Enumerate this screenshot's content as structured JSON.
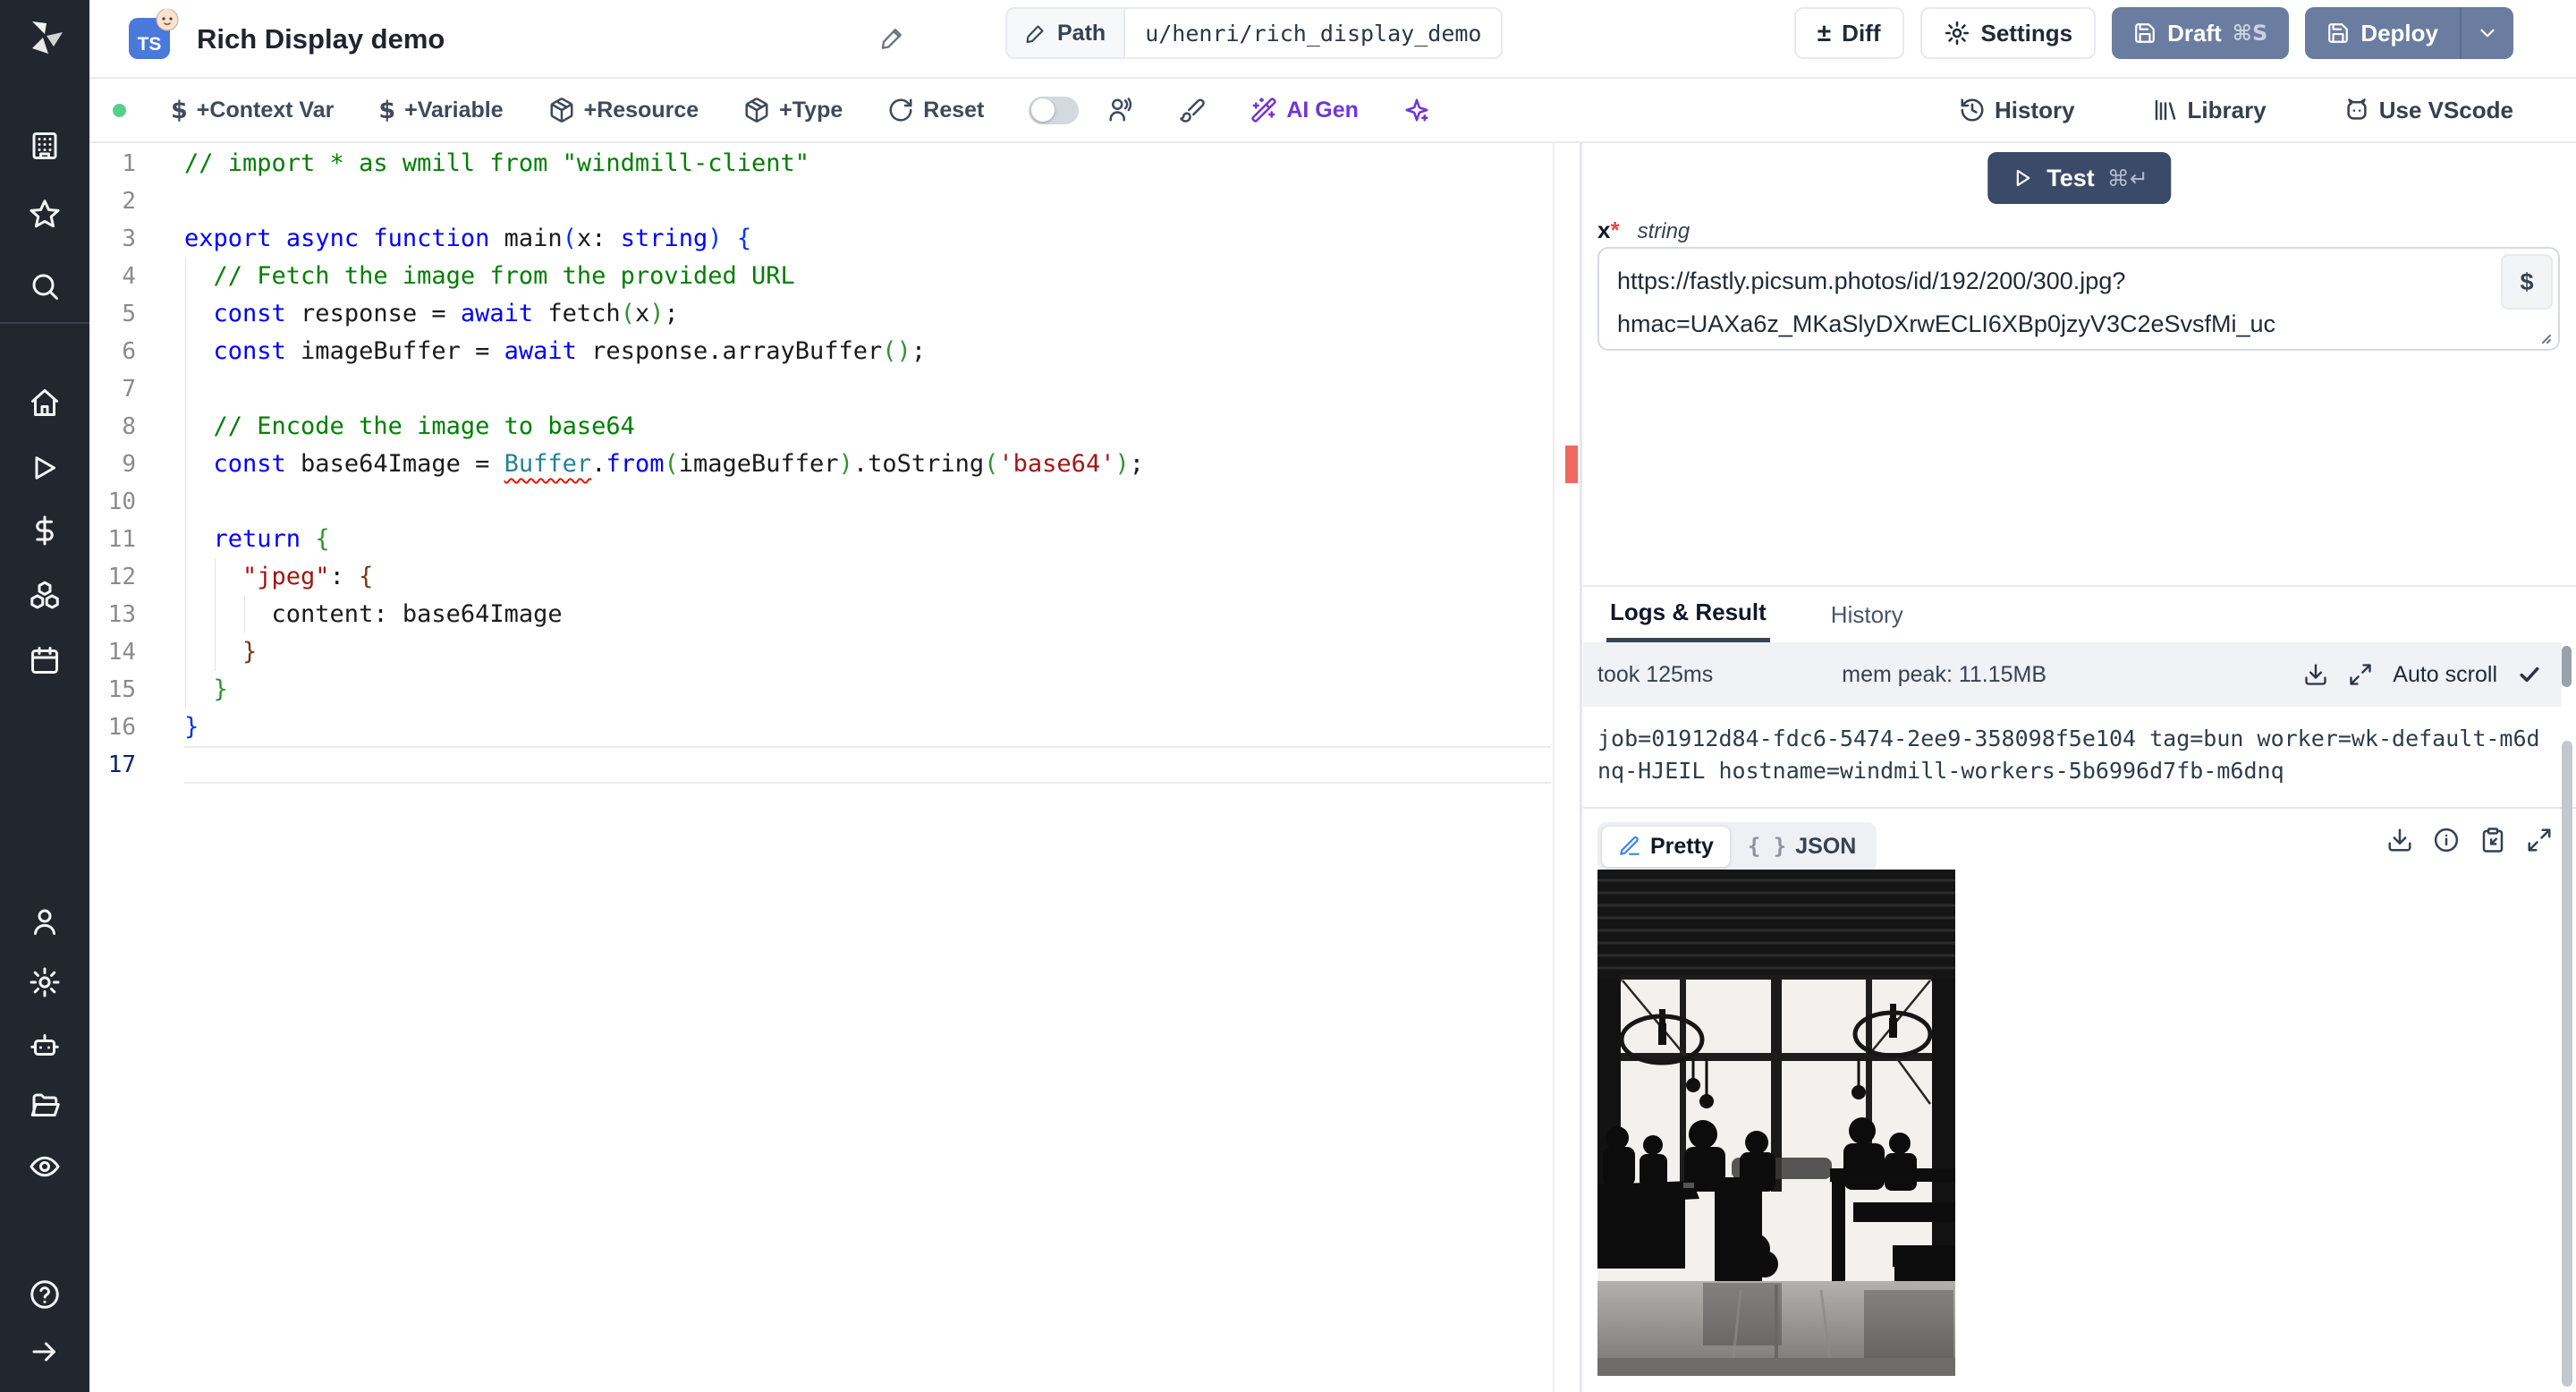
{
  "window": {
    "title": "Rich Display demo",
    "lang_badge": "TS",
    "path_label": "Path",
    "path_value": "u/henri/rich_display_demo",
    "buttons": {
      "diff": "Diff",
      "settings": "Settings",
      "draft": "Draft",
      "draft_shortcut": "⌘S",
      "deploy": "Deploy"
    }
  },
  "toolbar": {
    "dollar": "$",
    "diff_glyph": "±",
    "add_context_var": "+Context Var",
    "add_variable": "+Variable",
    "add_resource": "+Resource",
    "add_type": "+Type",
    "reset": "Reset",
    "ai_gen": "AI Gen",
    "history": "History",
    "library": "Library",
    "use_vscode": "Use VScode"
  },
  "editor": {
    "active_line": 17,
    "lines": [
      {
        "tokens": [
          [
            "cm",
            "// import * as wmill from \"windmill-client\""
          ]
        ]
      },
      {
        "tokens": []
      },
      {
        "tokens": [
          [
            "kw",
            "export"
          ],
          [
            "pl",
            " "
          ],
          [
            "kw",
            "async"
          ],
          [
            "pl",
            " "
          ],
          [
            "kw",
            "function"
          ],
          [
            "pl",
            " main"
          ],
          [
            "b1",
            "("
          ],
          [
            "pl",
            "x: "
          ],
          [
            "kw",
            "string"
          ],
          [
            "b1",
            ")"
          ],
          [
            "pl",
            " "
          ],
          [
            "b1",
            "{"
          ]
        ]
      },
      {
        "tokens": [
          [
            "pl",
            "  "
          ],
          [
            "cm",
            "// Fetch the image from the provided URL"
          ]
        ]
      },
      {
        "tokens": [
          [
            "pl",
            "  "
          ],
          [
            "kw",
            "const"
          ],
          [
            "pl",
            " response = "
          ],
          [
            "kw",
            "await"
          ],
          [
            "pl",
            " fetch"
          ],
          [
            "b2",
            "("
          ],
          [
            "pl",
            "x"
          ],
          [
            "b2",
            ")"
          ],
          [
            "pl",
            ";"
          ]
        ]
      },
      {
        "tokens": [
          [
            "pl",
            "  "
          ],
          [
            "kw",
            "const"
          ],
          [
            "pl",
            " imageBuffer = "
          ],
          [
            "kw",
            "await"
          ],
          [
            "pl",
            " response.arrayBuffer"
          ],
          [
            "b2",
            "()"
          ],
          [
            "pl",
            ";"
          ]
        ]
      },
      {
        "tokens": []
      },
      {
        "tokens": [
          [
            "pl",
            "  "
          ],
          [
            "cm",
            "// Encode the image to base64"
          ]
        ]
      },
      {
        "tokens": [
          [
            "pl",
            "  "
          ],
          [
            "kw",
            "const"
          ],
          [
            "pl",
            " base64Image = "
          ],
          [
            "tyerr",
            "Buffer"
          ],
          [
            "pl",
            "."
          ],
          [
            "kw",
            "from"
          ],
          [
            "b2",
            "("
          ],
          [
            "pl",
            "imageBuffer"
          ],
          [
            "b2",
            ")"
          ],
          [
            "pl",
            ".toString"
          ],
          [
            "b2",
            "("
          ],
          [
            "str",
            "'base64'"
          ],
          [
            "b2",
            ")"
          ],
          [
            "pl",
            ";"
          ]
        ]
      },
      {
        "tokens": []
      },
      {
        "tokens": [
          [
            "pl",
            "  "
          ],
          [
            "kw",
            "return"
          ],
          [
            "pl",
            " "
          ],
          [
            "b2",
            "{"
          ]
        ]
      },
      {
        "tokens": [
          [
            "pl",
            "    "
          ],
          [
            "str",
            "\"jpeg\""
          ],
          [
            "pl",
            ": "
          ],
          [
            "b3",
            "{"
          ]
        ]
      },
      {
        "tokens": [
          [
            "pl",
            "      content: base64Image"
          ]
        ]
      },
      {
        "tokens": [
          [
            "pl",
            "    "
          ],
          [
            "b3",
            "}"
          ]
        ]
      },
      {
        "tokens": [
          [
            "pl",
            "  "
          ],
          [
            "b2",
            "}"
          ]
        ]
      },
      {
        "tokens": [
          [
            "b1",
            "}"
          ]
        ]
      },
      {
        "tokens": []
      }
    ]
  },
  "run": {
    "test_label": "Test",
    "test_shortcut": "⌘↵"
  },
  "args": {
    "name": "x",
    "required": "*",
    "type": "string",
    "value": "https://fastly.picsum.photos/id/192/200/300.jpg?hmac=UAXa6z_MKaSlyDXrwECLI6XBp0jzyV3C2eSvsfMi_uc",
    "var_picker": "$"
  },
  "results": {
    "tab_logs": "Logs & Result",
    "tab_history": "History",
    "took": "took 125ms",
    "mem_peak": "mem peak: 11.15MB",
    "auto_scroll": "Auto scroll",
    "log_line": "job=01912d84-fdc6-5474-2ee9-358098f5e104 tag=bun worker=wk-default-m6dnq-HJEIL hostname=windmill-workers-5b6996d7fb-m6dnq",
    "tab_pretty": "Pretty",
    "tab_json": "JSON",
    "json_glyph": "{ }"
  },
  "colors": {
    "accent_slate": "#6a7da0",
    "test_button": "#3b4a68",
    "ai_purple": "#7135d6",
    "error_marker": "#ee6a5e",
    "green_dot": "#55d08a",
    "ts_badge": "#4a79dc",
    "pretty_pen": "#3b82f6"
  }
}
